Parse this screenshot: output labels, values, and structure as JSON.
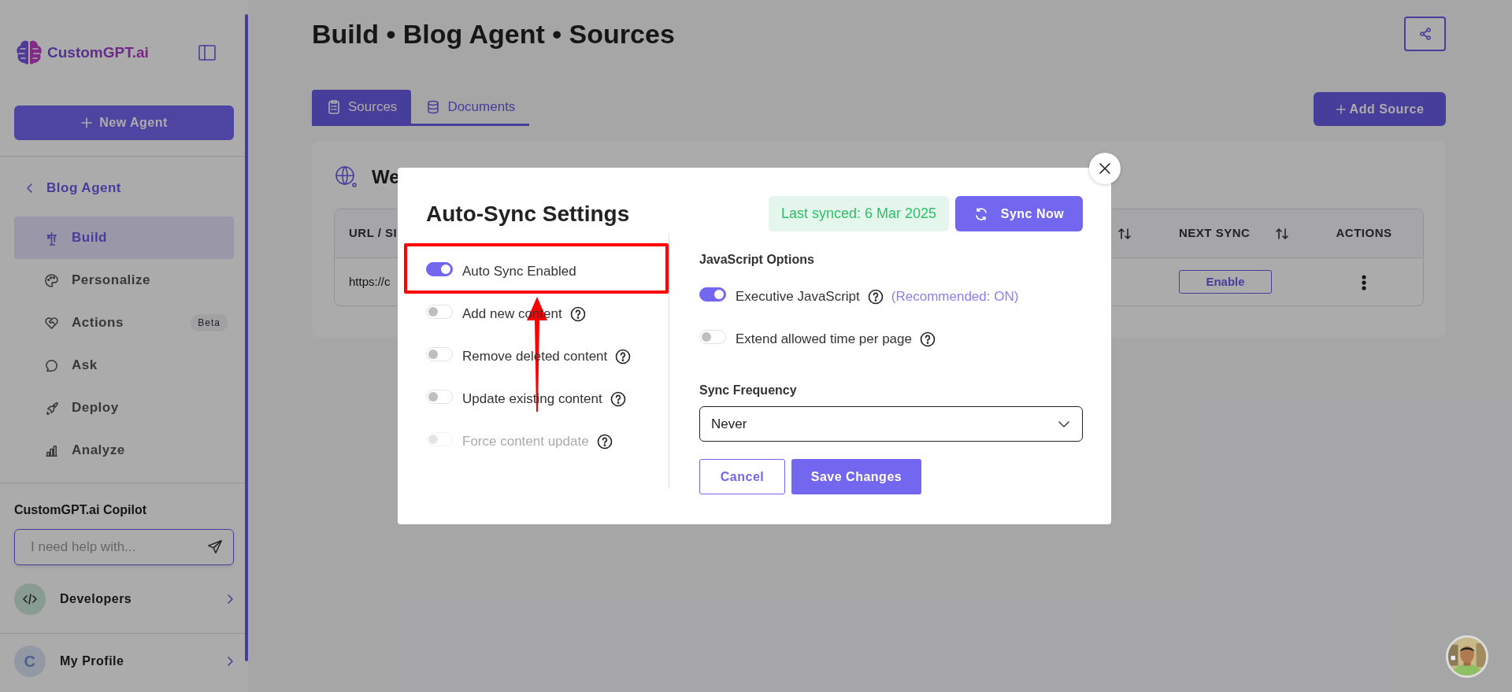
{
  "sidebar": {
    "logo_text": "CustomGPT.ai",
    "new_agent_button": "New Agent",
    "back_link": "Blog Agent",
    "items": [
      {
        "label": "Build",
        "selected": true
      },
      {
        "label": "Personalize",
        "selected": false
      },
      {
        "label": "Actions",
        "selected": false,
        "badge": "Beta"
      },
      {
        "label": "Ask",
        "selected": false
      },
      {
        "label": "Deploy",
        "selected": false
      },
      {
        "label": "Analyze",
        "selected": false
      }
    ],
    "copilot": {
      "title": "CustomGPT.ai Copilot",
      "placeholder": "I need help with..."
    },
    "developers": {
      "label": "Developers"
    },
    "profile": {
      "label": "My Profile",
      "avatar_text": "C"
    }
  },
  "page": {
    "title": "Build • Blog Agent • Sources",
    "tabs": [
      {
        "label": "Sources",
        "selected": true
      },
      {
        "label": "Documents",
        "selected": false
      }
    ],
    "add_source_button": "Add Source"
  },
  "card": {
    "title": "We",
    "table": {
      "columns": [
        {
          "label": "URL / SI"
        },
        {
          "sortable": true
        },
        {
          "label": "NEXT SYNC",
          "sortable": true
        },
        {
          "label": "ACTIONS",
          "sortable": false
        }
      ],
      "rows": [
        {
          "url": "https://c",
          "next_sync_button": "Enable"
        }
      ]
    }
  },
  "modal": {
    "title": "Auto-Sync Settings",
    "last_synced": "Last synced: 6 Mar 2025",
    "sync_now_button": "Sync Now",
    "sync_options": [
      {
        "label": "Auto Sync Enabled",
        "on": true,
        "disabled": false,
        "help": false
      },
      {
        "label": "Add new content",
        "on": false,
        "disabled": false,
        "help": true
      },
      {
        "label": "Remove deleted content",
        "on": false,
        "disabled": false,
        "help": true
      },
      {
        "label": "Update existing content",
        "on": false,
        "disabled": false,
        "help": true
      },
      {
        "label": "Force content update",
        "on": false,
        "disabled": true,
        "help": true
      }
    ],
    "javascript_options": {
      "title": "JavaScript Options",
      "items": [
        {
          "label": "Executive JavaScript",
          "on": true,
          "help": true,
          "note": "(Recommended: ON)"
        },
        {
          "label": "Extend allowed time per page",
          "on": false,
          "help": true
        }
      ]
    },
    "sync_frequency": {
      "label": "Sync Frequency",
      "value": "Never"
    },
    "cancel_button": "Cancel",
    "save_button": "Save Changes"
  }
}
